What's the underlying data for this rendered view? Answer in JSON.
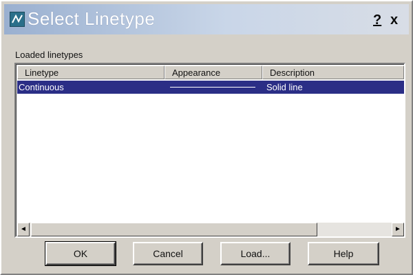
{
  "window": {
    "title": "Select Linetype",
    "help_glyph": "?",
    "close_glyph": "x",
    "icon": "app-icon"
  },
  "section": {
    "label": "Loaded linetypes"
  },
  "table": {
    "columns": [
      "Linetype",
      "Appearance",
      "Description"
    ],
    "rows": [
      {
        "linetype": "Continuous",
        "appearance": "solid-line",
        "description": "Solid line",
        "selected": true
      }
    ]
  },
  "scrollbar": {
    "left_arrow": "◄",
    "right_arrow": "►"
  },
  "buttons": {
    "ok": "OK",
    "cancel": "Cancel",
    "load": "Load...",
    "help": "Help"
  },
  "colors": {
    "selection": "#2b2e86",
    "dialog_face": "#d4d0c8"
  }
}
